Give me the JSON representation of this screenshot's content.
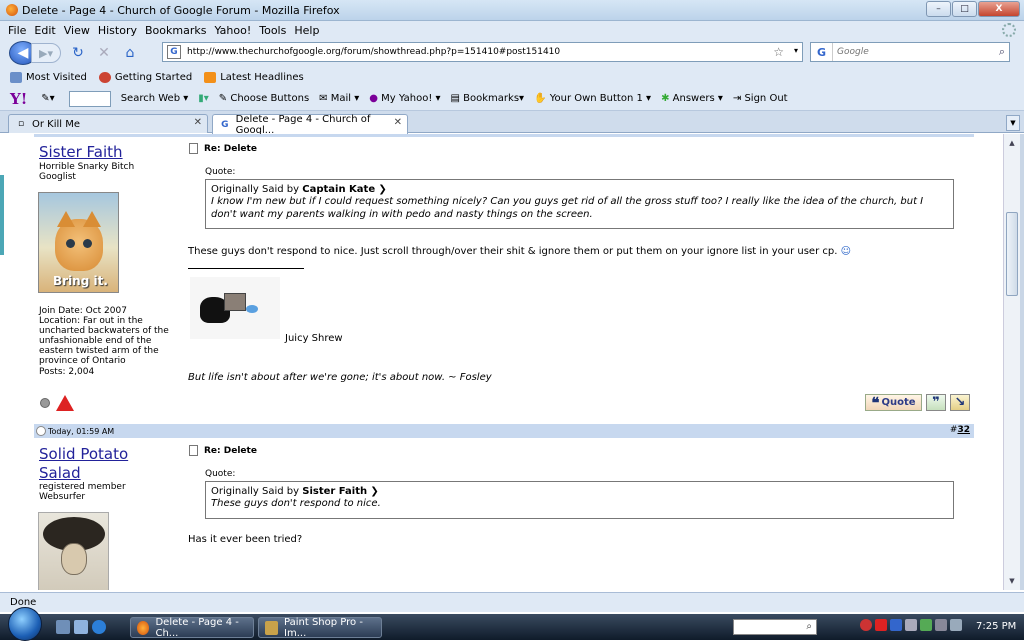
{
  "window": {
    "title": "Delete - Page 4 - Church of Google Forum - Mozilla Firefox",
    "minimize": "–",
    "maximize": "□",
    "close": "X"
  },
  "menu": [
    "File",
    "Edit",
    "View",
    "History",
    "Bookmarks",
    "Yahoo!",
    "Tools",
    "Help"
  ],
  "nav": {
    "url": "http://www.thechurchofgoogle.org/forum/showthread.php?p=151410#post151410",
    "search_placeholder": "Google",
    "search_engine_icon": "G"
  },
  "bookmarks": [
    "Most Visited",
    "Getting Started",
    "Latest Headlines"
  ],
  "yahoo_toolbar": {
    "logo": "Y!",
    "items": [
      "Search Web",
      "Choose Buttons",
      "Mail",
      "My Yahoo!",
      "Bookmarks",
      "Your Own Button 1",
      "Answers",
      "Sign Out"
    ]
  },
  "tabs": [
    {
      "label": "Or Kill Me",
      "active": false
    },
    {
      "label": "Delete - Page 4 - Church of Googl...",
      "active": true
    }
  ],
  "post1": {
    "username": "Sister Faith",
    "user_title": "Horrible Snarky Bitch",
    "user_rank": "Googlist",
    "avatar_caption": "Bring it.",
    "join_date": "Join Date: Oct 2007",
    "location_lines": [
      "Location: Far out in the",
      "uncharted backwaters of the",
      "unfashionable end of the",
      "eastern twisted arm of the",
      "province of Ontario"
    ],
    "posts": "Posts: 2,004",
    "title": "Re: Delete",
    "quote_label": "Quote:",
    "quote_by_prefix": "Originally Said by",
    "quote_author": "Captain Kate",
    "quote_text": "I know I'm new but if I could request something nicely? Can you guys get rid of all the gross stuff too? I really like the idea of the church, but I don't want my parents walking in with pedo and nasty things on the screen.",
    "body": "These guys don't respond to nice. Just scroll through/over their shit & ignore them or put them on your ignore list in your user cp.",
    "sig_caption": "Juicy Shrew",
    "sig_quote": "But life isn't about after we're gone; it's about now. ~ Fosley",
    "quote_button": "Quote"
  },
  "post2": {
    "timestamp": "Today, 01:59 AM",
    "post_number_prefix": "#",
    "post_number": "32",
    "username_line1": "Solid Potato",
    "username_line2": "Salad",
    "user_title": "registered member",
    "user_rank": "Websurfer",
    "title": "Re: Delete",
    "quote_label": "Quote:",
    "quote_by_prefix": "Originally Said by",
    "quote_author": "Sister Faith",
    "quote_text": "These guys don't respond to nice.",
    "body": "Has it ever been tried?"
  },
  "status": "Done",
  "taskbar": {
    "buttons": [
      "Delete - Page 4 - Ch...",
      "Paint Shop Pro - Im..."
    ],
    "time": "7:25 PM"
  }
}
